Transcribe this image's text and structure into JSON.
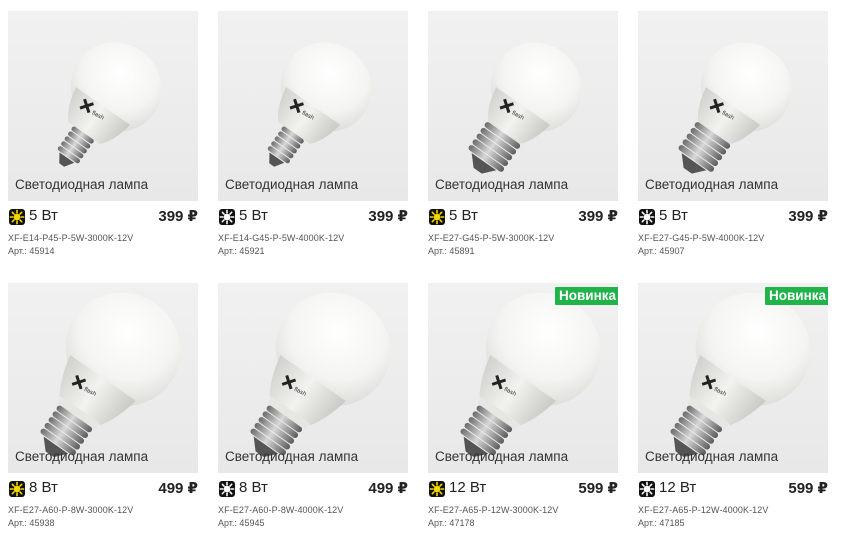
{
  "products": [
    {
      "badge": "",
      "caption": "Светодиодная лампа",
      "color": "warm",
      "watt": "5 Вт",
      "price": "399 ₽",
      "sku": "XF-E14-P45-P-5W-3000K-12V",
      "art": "Арт.: 45914",
      "shape": "small",
      "base": "e14"
    },
    {
      "badge": "",
      "caption": "Светодиодная лампа",
      "color": "cold",
      "watt": "5 Вт",
      "price": "399 ₽",
      "sku": "XF-E14-G45-P-5W-4000K-12V",
      "art": "Арт.: 45921",
      "shape": "small",
      "base": "e14"
    },
    {
      "badge": "",
      "caption": "Светодиодная лампа",
      "color": "warm",
      "watt": "5 Вт",
      "price": "399 ₽",
      "sku": "XF-E27-G45-P-5W-3000K-12V",
      "art": "Арт.: 45891",
      "shape": "small",
      "base": "e27"
    },
    {
      "badge": "",
      "caption": "Светодиодная лампа",
      "color": "cold",
      "watt": "5 Вт",
      "price": "399 ₽",
      "sku": "XF-E27-G45-P-5W-4000K-12V",
      "art": "Арт.: 45907",
      "shape": "small",
      "base": "e27"
    },
    {
      "badge": "",
      "caption": "Светодиодная лампа",
      "color": "warm",
      "watt": "8 Вт",
      "price": "499 ₽",
      "sku": "XF-E27-A60-P-8W-3000K-12V",
      "art": "Арт.: 45938",
      "shape": "large",
      "base": "e27"
    },
    {
      "badge": "",
      "caption": "Светодиодная лампа",
      "color": "cold",
      "watt": "8 Вт",
      "price": "499 ₽",
      "sku": "XF-E27-A60-P-8W-4000K-12V",
      "art": "Арт.: 45945",
      "shape": "large",
      "base": "e27"
    },
    {
      "badge": "Новинка",
      "caption": "Светодиодная лампа",
      "color": "warm",
      "watt": "12 Вт",
      "price": "599 ₽",
      "sku": "XF-E27-A65-P-12W-3000K-12V",
      "art": "Арт.: 47178",
      "shape": "large",
      "base": "e27"
    },
    {
      "badge": "Новинка",
      "caption": "Светодиодная лампа",
      "color": "cold",
      "watt": "12 Вт",
      "price": "599 ₽",
      "sku": "XF-E27-A65-P-12W-4000K-12V",
      "art": "Арт.: 47185",
      "shape": "large",
      "base": "e27"
    }
  ],
  "colors": {
    "warm_icon": "#f5d800",
    "cold_icon": "#ffffff",
    "badge_bg": "#21b24a"
  }
}
